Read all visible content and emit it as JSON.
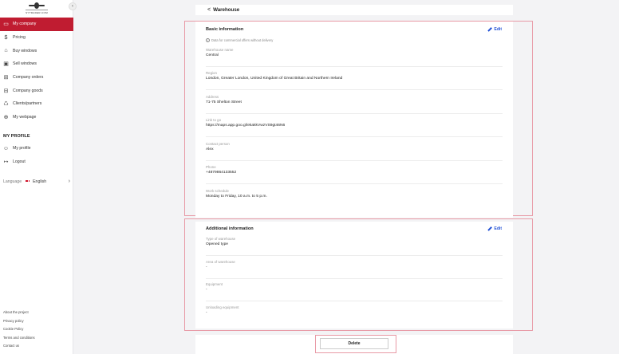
{
  "logo": {
    "text": "SYTRADER.COM"
  },
  "sidebar": {
    "items": [
      {
        "label": "My company",
        "icon": "briefcase-icon",
        "glyph": "▭",
        "active": true
      },
      {
        "label": "Pricing",
        "icon": "dollar-icon",
        "glyph": "$",
        "active": false
      },
      {
        "label": "Buy windows",
        "icon": "basket-icon",
        "glyph": "⌂",
        "active": false
      },
      {
        "label": "Sell windows",
        "icon": "box-icon",
        "glyph": "▣",
        "active": false
      },
      {
        "label": "Company orders",
        "icon": "cart-icon",
        "glyph": "⊞",
        "active": false
      },
      {
        "label": "Company goods",
        "icon": "grid-icon",
        "glyph": "⊟",
        "active": false
      },
      {
        "label": "Clients/partners",
        "icon": "handshake-icon",
        "glyph": "♺",
        "active": false
      },
      {
        "label": "My webpage",
        "icon": "globe-icon",
        "glyph": "⊕",
        "active": false
      }
    ],
    "profile_title": "MY PROFILE",
    "profile_items": [
      {
        "label": "My profile",
        "icon": "user-icon",
        "glyph": "☺"
      },
      {
        "label": "Logout",
        "icon": "logout-icon",
        "glyph": "↦"
      }
    ],
    "language_label": "Language",
    "language_value": "English",
    "footer_links": [
      "About the project",
      "Privacy policy",
      "Cookie Policy",
      "Terms and conditions",
      "Contact us"
    ]
  },
  "header": {
    "back": "<",
    "title": "Warehouse"
  },
  "basic": {
    "title": "Basic information",
    "edit_label": "Edit",
    "note": "Data for commercial offers without delivery",
    "fields": [
      {
        "label": "Warehouse name",
        "value": "Central"
      },
      {
        "label": "Region",
        "value": "London, Greater London, United Kingdom of Great Britain and Northern Ireland"
      },
      {
        "label": "Address",
        "value": "71-75 Shelton Street"
      },
      {
        "label": "Link to go",
        "value": "https://maps.app.goo.gl/ekakkVwzVS9gt46N6"
      },
      {
        "label": "Contact person",
        "value": "Alex"
      },
      {
        "label": "Phone",
        "value": "+4879864133552"
      },
      {
        "label": "Work schedule",
        "value": "Monday to Friday, 10 a.m. to 5 p.m."
      }
    ]
  },
  "additional": {
    "title": "Additional information",
    "edit_label": "Edit",
    "fields": [
      {
        "label": "Type of warehouse",
        "value": "Opened type"
      },
      {
        "label": "Area of warehouse",
        "value": "-"
      },
      {
        "label": "Equipment",
        "value": "-"
      },
      {
        "label": "Unloading equipment",
        "value": "-"
      }
    ]
  },
  "actions": {
    "delete_label": "Delete"
  }
}
